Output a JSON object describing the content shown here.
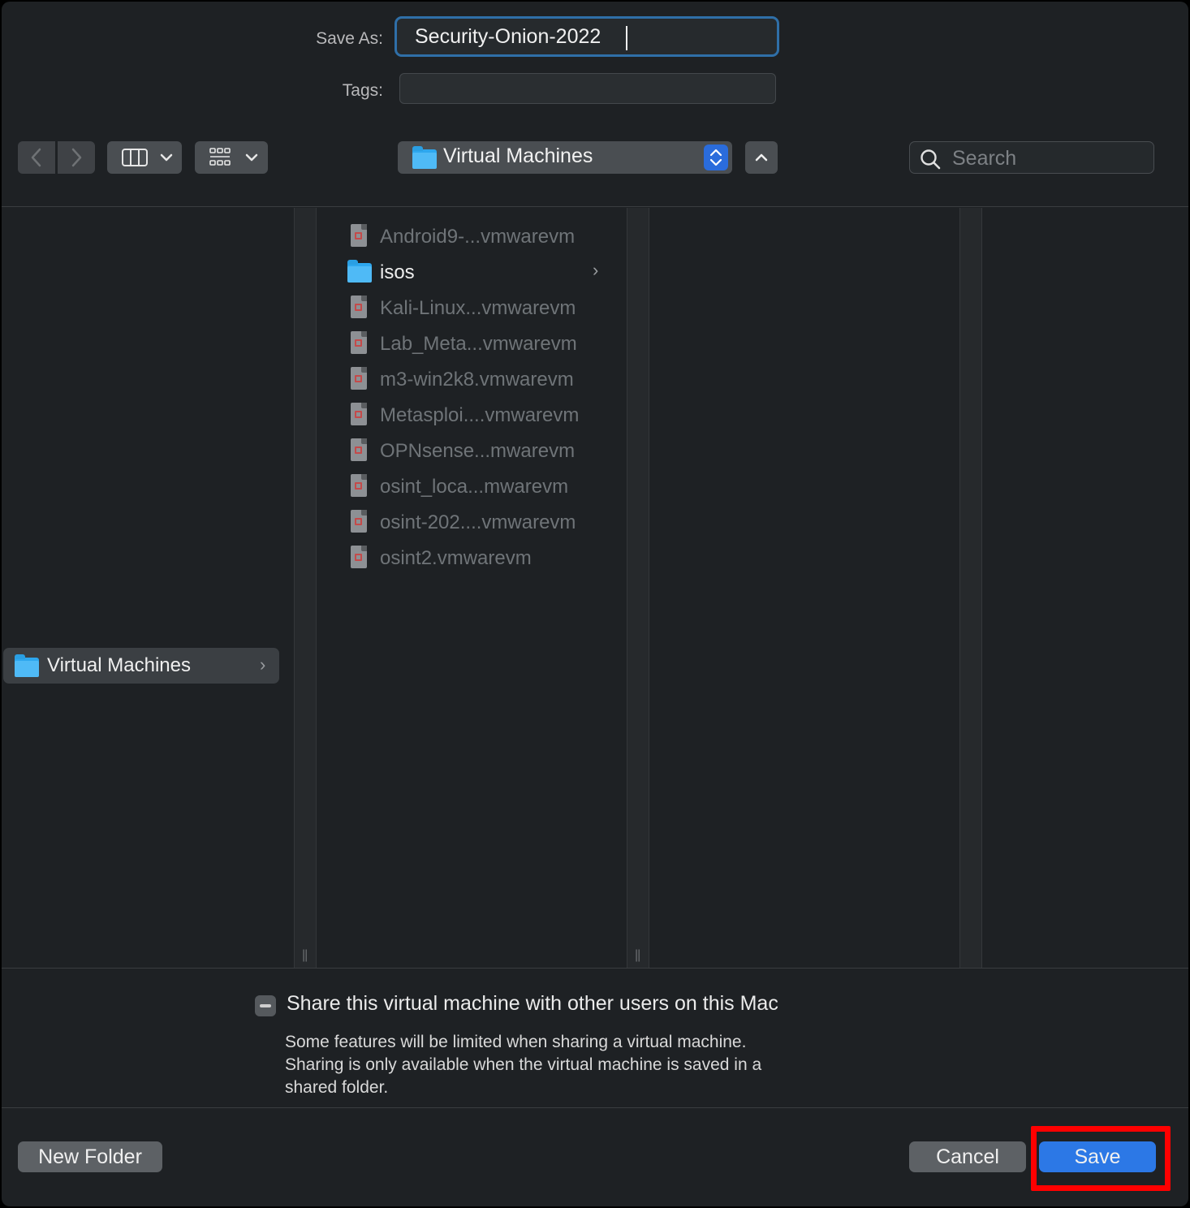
{
  "save_as": {
    "label": "Save As:",
    "value": "Security-Onion-2022"
  },
  "tags": {
    "label": "Tags:",
    "value": ""
  },
  "toolbar": {
    "location": "Virtual Machines",
    "search_placeholder": "Search"
  },
  "sidebar": {
    "selected_item": "Virtual Machines"
  },
  "files": [
    {
      "name": "Android9-...vmwarevm",
      "type": "vmwarevm"
    },
    {
      "name": "isos",
      "type": "folder"
    },
    {
      "name": "Kali-Linux...vmwarevm",
      "type": "vmwarevm"
    },
    {
      "name": "Lab_Meta...vmwarevm",
      "type": "vmwarevm"
    },
    {
      "name": "m3-win2k8.vmwarevm",
      "type": "vmwarevm"
    },
    {
      "name": "Metasploi....vmwarevm",
      "type": "vmwarevm"
    },
    {
      "name": "OPNsense...mwarevm",
      "type": "vmwarevm"
    },
    {
      "name": "osint_loca...mwarevm",
      "type": "vmwarevm"
    },
    {
      "name": "osint-202....vmwarevm",
      "type": "vmwarevm"
    },
    {
      "name": "osint2.vmwarevm",
      "type": "vmwarevm"
    }
  ],
  "share": {
    "label": "Share this virtual machine with other users on this Mac",
    "note_line1": "Some features will be limited when sharing a virtual machine.",
    "note_line2": "Sharing is only available when the virtual machine is saved in a",
    "note_line3": "shared folder."
  },
  "buttons": {
    "new_folder": "New Folder",
    "cancel": "Cancel",
    "save": "Save"
  },
  "colors": {
    "accent": "#2c78e6",
    "highlight": "#ff0000",
    "folder": "#4fbaf6"
  }
}
